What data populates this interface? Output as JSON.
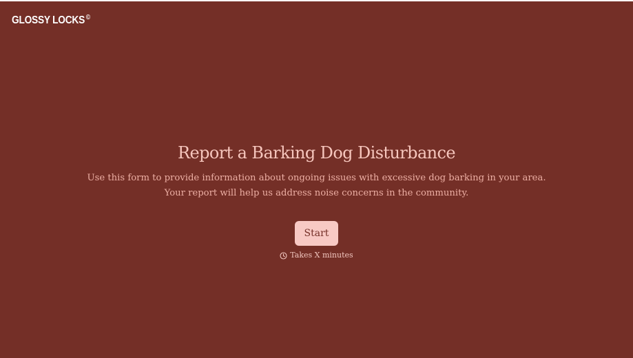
{
  "brand": {
    "name": "GLOSSY LOCKS",
    "mark": "©"
  },
  "hero": {
    "title": "Report a Barking Dog Disturbance",
    "description_line1": "Use this form to provide information about ongoing issues with excessive dog barking in your area.",
    "description_line2": "Your report will help us address noise concerns in the community."
  },
  "actions": {
    "start_label": "Start"
  },
  "meta": {
    "duration_icon": "clock-icon",
    "duration_text": "Takes X minutes"
  },
  "colors": {
    "background": "#742f27",
    "title_text": "#f6c6bd",
    "description_text": "#ecaea3",
    "button_background": "#f8c9c4",
    "button_text": "#742f27"
  }
}
